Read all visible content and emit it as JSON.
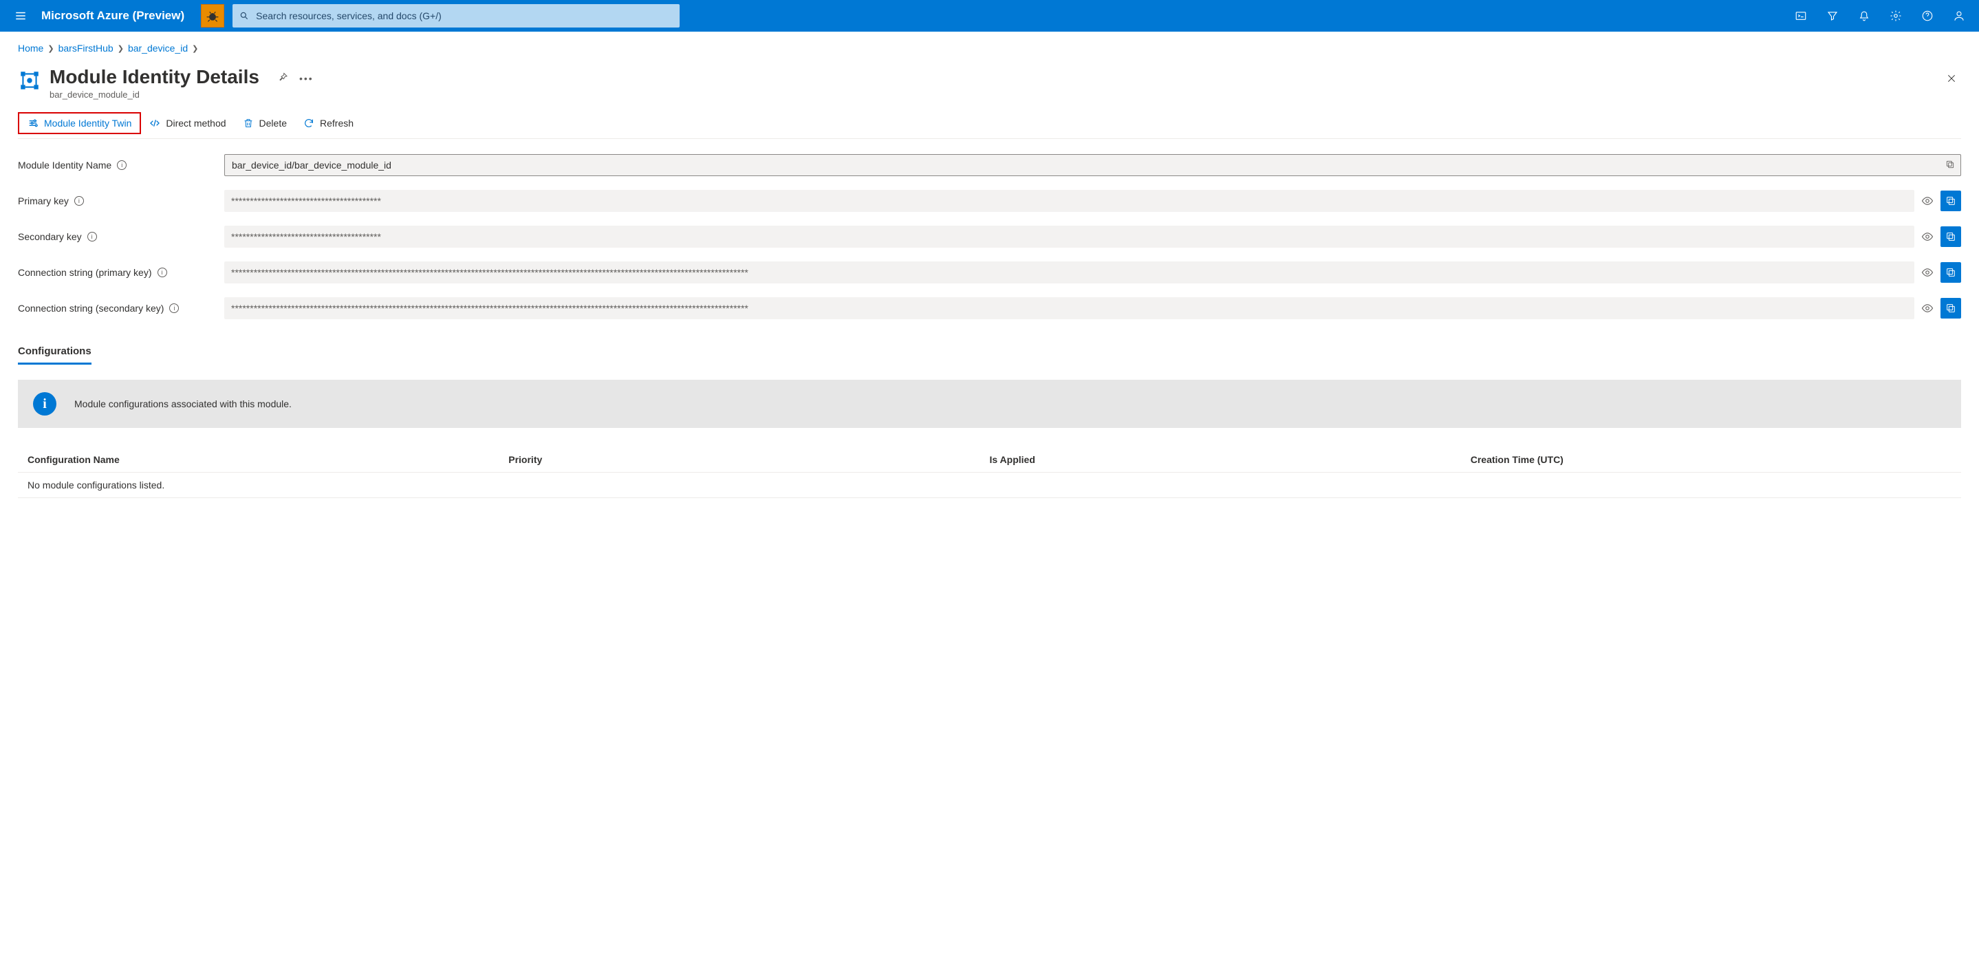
{
  "topbar": {
    "brand": "Microsoft Azure (Preview)",
    "search_placeholder": "Search resources, services, and docs (G+/)"
  },
  "breadcrumbs": {
    "items": [
      "Home",
      "barsFirstHub",
      "bar_device_id"
    ]
  },
  "header": {
    "title": "Module Identity Details",
    "subtitle": "bar_device_module_id"
  },
  "toolbar": {
    "twin": "Module Identity Twin",
    "direct_method": "Direct method",
    "delete": "Delete",
    "refresh": "Refresh"
  },
  "form": {
    "name_label": "Module Identity Name",
    "name_value": "bar_device_id/bar_device_module_id",
    "primary_key_label": "Primary key",
    "primary_key_value": "****************************************",
    "secondary_key_label": "Secondary key",
    "secondary_key_value": "****************************************",
    "conn_primary_label": "Connection string (primary key)",
    "conn_primary_value": "******************************************************************************************************************************************",
    "conn_secondary_label": "Connection string (secondary key)",
    "conn_secondary_value": "******************************************************************************************************************************************"
  },
  "config": {
    "heading": "Configurations",
    "banner_text": "Module configurations associated with this module.",
    "columns": {
      "name": "Configuration Name",
      "priority": "Priority",
      "applied": "Is Applied",
      "created": "Creation Time (UTC)"
    },
    "empty": "No module configurations listed."
  }
}
